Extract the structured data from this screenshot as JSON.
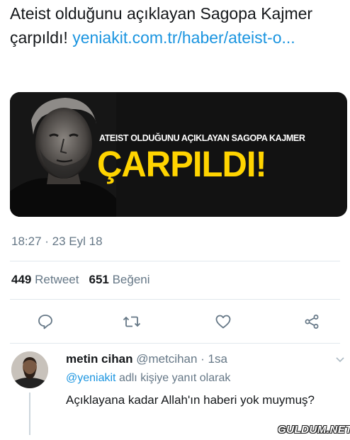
{
  "tweet": {
    "text": "Ateist olduğunu açıklayan Sagopa Kajmer çarpıldı!",
    "link": "yeniakit.com.tr/haber/ateist-o..."
  },
  "media": {
    "headline_small": "ATEIST OLDUĞUNU AÇIKLAYAN SAGOPA KAJMER",
    "headline_big": "ÇARPILDI!",
    "background_color": "#121212",
    "headline_color": "#ffd400"
  },
  "timestamp": "18:27 · 23 Eyl 18",
  "stats": {
    "retweet_count": "449",
    "retweet_label": "Retweet",
    "like_count": "651",
    "like_label": "Beğeni"
  },
  "actions": [
    "reply-icon",
    "retweet-icon",
    "like-icon",
    "share-icon"
  ],
  "reply": {
    "display_name": "metin cihan",
    "handle_time": "@metcihan · 1sa",
    "reply_to_mention": "@yeniakit",
    "reply_to_suffix": "adlı kişiye yanıt olarak",
    "body": "Açıklayana kadar Allah'ın haberi yok muymuş?"
  },
  "watermark": "GULDUM.NET",
  "colors": {
    "link": "#1b95e0",
    "secondary_text": "#657786",
    "primary_text": "#14171a",
    "divider": "#e1e8ed"
  }
}
